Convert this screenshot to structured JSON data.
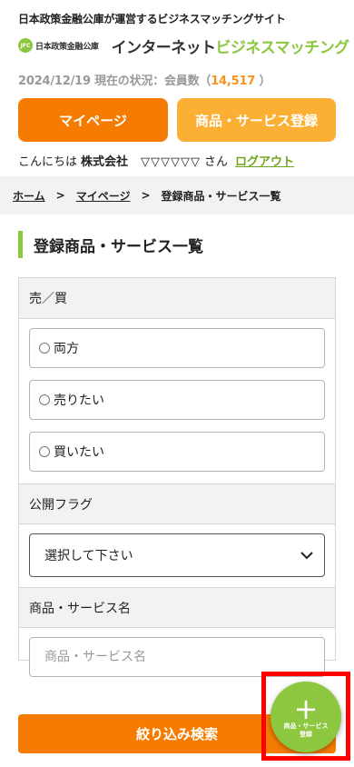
{
  "header": {
    "tagline": "日本政策金融公庫が運営するビジネスマッチングサイト",
    "logo_mark": "JFC",
    "logo_org": "日本政策金融公庫",
    "site_name_part1": "インターネット",
    "site_name_part2": "ビジネスマッチング"
  },
  "status": {
    "prefix": "2024/12/19 現在の状況：会員数（",
    "member_count": "14,517",
    "suffix": " ）"
  },
  "nav_buttons": {
    "mypage": "マイページ",
    "register": "商品・サービス登録"
  },
  "greeting": {
    "hello": "こんにちは",
    "company": "株式会社",
    "person": "▽▽▽▽▽▽",
    "san": "さん",
    "logout": "ログアウト"
  },
  "breadcrumb": {
    "home": "ホーム",
    "mypage": "マイページ",
    "current": "登録商品・サービス一覧",
    "separator": ">"
  },
  "page_title": "登録商品・サービス一覧",
  "filters": {
    "buy_sell": {
      "label": "売／買",
      "options": [
        "両方",
        "売りたい",
        "買いたい"
      ]
    },
    "public_flag": {
      "label": "公開フラグ",
      "selected": "選択して下さい"
    },
    "product_name": {
      "label": "商品・サービス名",
      "placeholder": "商品・サービス名"
    }
  },
  "search_button": "絞り込み検索",
  "fab": {
    "icon": "plus-icon",
    "label_line1": "商品・サービス",
    "label_line2": "登録"
  },
  "colors": {
    "orange": "#f57c00",
    "light_orange": "#fbb034",
    "green": "#8dc63f",
    "highlight": "#ff0000"
  }
}
